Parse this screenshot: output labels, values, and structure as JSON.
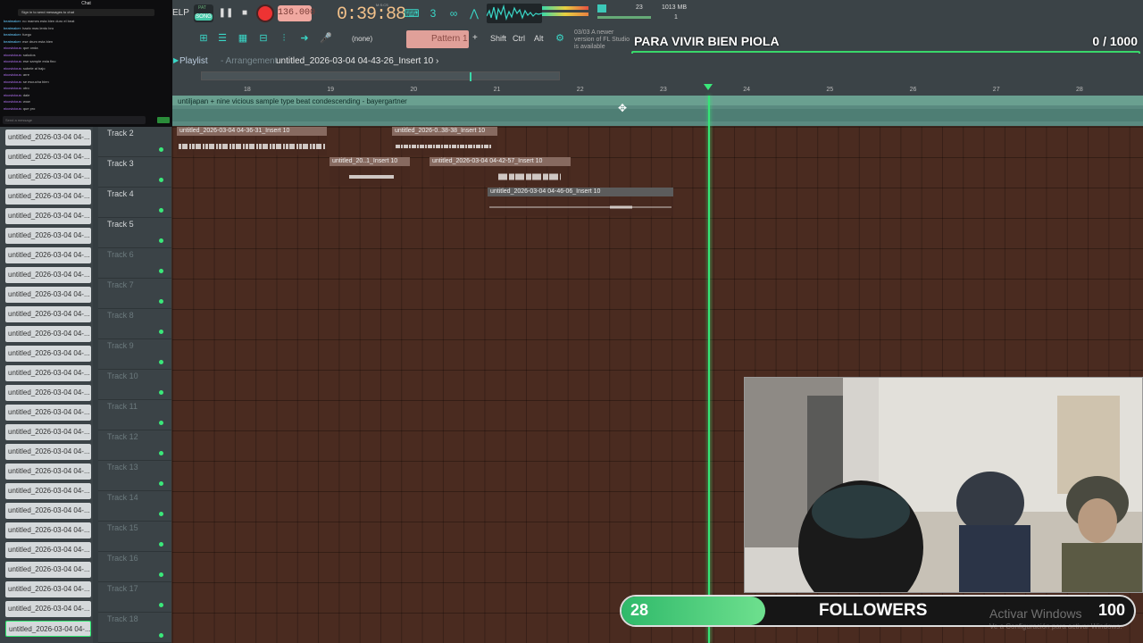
{
  "chat": {
    "header": "Chat",
    "notice": "Sign in to send messages to chat",
    "input_placeholder": "Send a message",
    "lines": [
      {
        "user": "beatmaker",
        "text": "no mames esta bien duro el beat"
      },
      {
        "user": "beatmaker",
        "text": "hazlo mas lento bro"
      },
      {
        "user": "beatmaker",
        "text": "fuego"
      },
      {
        "user": "beatmaker",
        "text": "ese drum esta bien"
      },
      {
        "user": "nicovicious",
        "text": "que onda"
      },
      {
        "user": "nicovicious",
        "text": "saludos"
      },
      {
        "user": "nicovicious",
        "text": "ese sample esta fino"
      },
      {
        "user": "nicovicious",
        "text": "subele al bajo"
      },
      {
        "user": "nicovicious",
        "text": "arre"
      },
      {
        "user": "nicovicious",
        "text": "se escucha bien"
      },
      {
        "user": "nicovicious",
        "text": "otro"
      },
      {
        "user": "nicovicious",
        "text": "dale"
      },
      {
        "user": "nicovicious",
        "text": "wow"
      },
      {
        "user": "nicovicious",
        "text": "que pro"
      }
    ]
  },
  "toolbar": {
    "help_label": "ELP",
    "pat_label": "PAT",
    "song_label": "SONG",
    "tempo": "136.000",
    "time_label": "M:S:CS",
    "time": "0:39:88",
    "cpu_voices": "23",
    "memory": "1013 MB",
    "memory_sub": "1",
    "none_label": "(none)",
    "pattern_label": "Pattern 1",
    "pattern_add": "+",
    "shift_label": "Shift",
    "ctrl_label": "Ctrl",
    "alt_label": "Alt",
    "news": "03/03  A newer version of FL Studio is available"
  },
  "goal": {
    "title": "PARA VIVIR BIEN PIOLA",
    "count": "0  / 1000"
  },
  "playlist": {
    "title": "Playlist",
    "subtitle": "- Arrangement",
    "pattern": "untitled_2026-03-04 04-43-26_Insert 10",
    "pattern_arrow": "›",
    "audio_track_label": "untiljapan + nine vicious sample type beat condescending - bayergartner",
    "ruler_numbers": [
      "18",
      "19",
      "20",
      "21",
      "22",
      "23",
      "24",
      "25",
      "26",
      "27",
      "28"
    ],
    "tracks": [
      {
        "name": "Track 2",
        "dim": false
      },
      {
        "name": "Track 3",
        "dim": false
      },
      {
        "name": "Track 4",
        "dim": false
      },
      {
        "name": "Track 5",
        "dim": false
      },
      {
        "name": "Track 6",
        "dim": true
      },
      {
        "name": "Track 7",
        "dim": true
      },
      {
        "name": "Track 8",
        "dim": true
      },
      {
        "name": "Track 9",
        "dim": true
      },
      {
        "name": "Track 10",
        "dim": true
      },
      {
        "name": "Track 11",
        "dim": true
      },
      {
        "name": "Track 12",
        "dim": true
      },
      {
        "name": "Track 13",
        "dim": true
      },
      {
        "name": "Track 14",
        "dim": true
      },
      {
        "name": "Track 15",
        "dim": true
      },
      {
        "name": "Track 16",
        "dim": true
      },
      {
        "name": "Track 17",
        "dim": true
      },
      {
        "name": "Track 18",
        "dim": true
      }
    ],
    "clips": [
      {
        "label": "untitled_2026-03-04 04-36-31_Insert 10"
      },
      {
        "label": "untitled_2026-0..38-38_Insert 10"
      },
      {
        "label": "untitled_20..1_Insert 10"
      },
      {
        "label": "untitled_2026-03-04 04-42-57_Insert 10"
      },
      {
        "label": "untitled_2026-03-04 04-46-06_Insert 10"
      }
    ],
    "pattern_list_item": "untitled_2026-03-04 04-..."
  },
  "followers": {
    "current": "28",
    "label": "FOLLOWERS",
    "goal": "100",
    "progress": 0.28
  },
  "watermark": {
    "title": "Activar Windows",
    "sub": "Ve a Configuración para activar Windows."
  }
}
